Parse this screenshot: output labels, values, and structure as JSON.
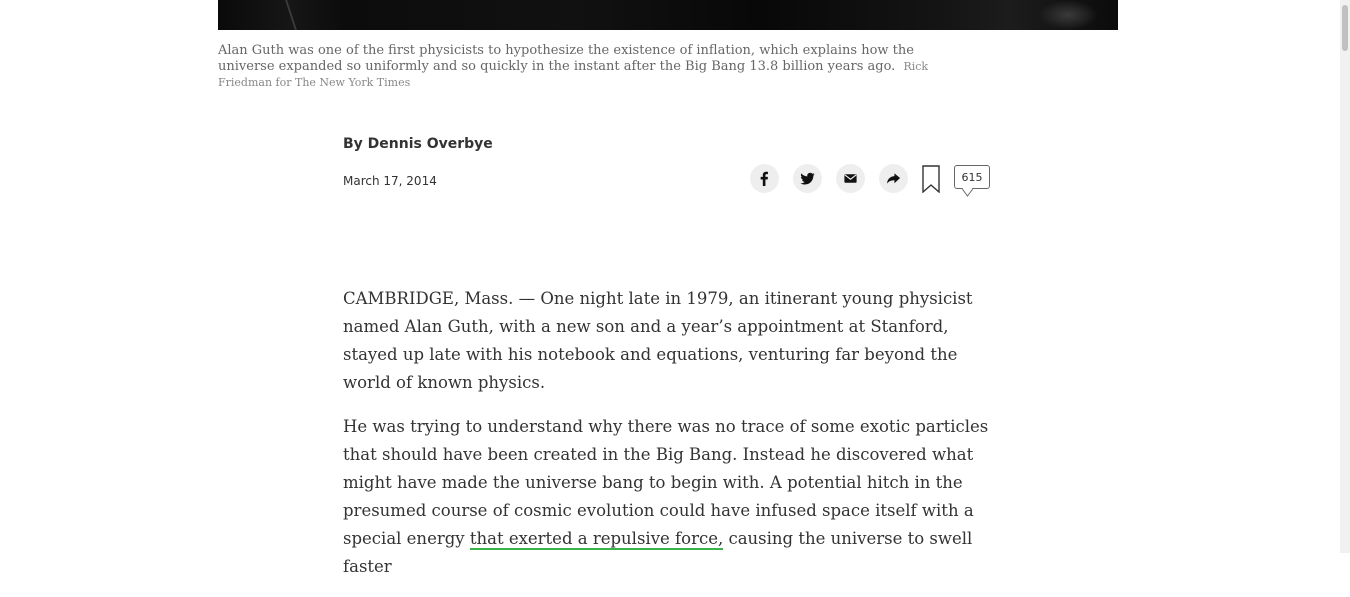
{
  "caption": {
    "text": "Alan Guth was one of the first physicists to hypothesize the existence of inflation, which explains how the universe expanded so uniformly and so quickly in the instant after the Big Bang 13.8 billion years ago.",
    "credit": "Rick Friedman for The New York Times"
  },
  "article": {
    "byline": "By Dennis Overbye",
    "date": "March 17, 2014",
    "comment_count": "615",
    "paragraphs": [
      "CAMBRIDGE, Mass. — One night late in 1979, an itinerant young physicist named Alan Guth, with a new son and a year’s appointment at Stanford, stayed up late with his notebook and equations, venturing far beyond the world of known physics.",
      "He was trying to understand why there was no trace of some exotic particles that should have been created in the Big Bang. Instead he discovered what might have made the universe bang to begin with. A potential hitch in the presumed course of cosmic evolution could have infused space itself with a special energy",
      "that exerted a repulsive force,",
      " causing the universe to swell faster"
    ]
  },
  "share": {
    "icons": [
      "facebook-icon",
      "twitter-icon",
      "email-icon",
      "share-icon",
      "bookmark-icon",
      "comments-icon"
    ]
  },
  "colors": {
    "highlight_green": "#3bb54a",
    "highlight_red": "#e23b3b",
    "text": "#333333",
    "button_bg": "#eeeeee"
  }
}
